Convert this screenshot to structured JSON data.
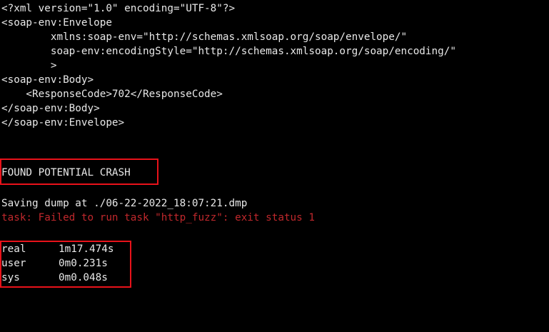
{
  "xml_lines": [
    "<?xml version=\"1.0\" encoding=\"UTF-8\"?>",
    "<soap-env:Envelope",
    "        xmlns:soap-env=\"http://schemas.xmlsoap.org/soap/envelope/\"",
    "        soap-env:encodingStyle=\"http://schemas.xmlsoap.org/soap/encoding/\"",
    "        >",
    "<soap-env:Body>",
    "    <ResponseCode>702</ResponseCode>",
    "</soap-env:Body>",
    "</soap-env:Envelope>"
  ],
  "crash_message": "FOUND POTENTIAL CRASH",
  "dump_message": "Saving dump at ./06-22-2022_18:07:21.dmp",
  "error_message": "task: Failed to run task \"http_fuzz\": exit status 1",
  "timing": [
    {
      "label": "real",
      "value": "1m17.474s"
    },
    {
      "label": "user",
      "value": "0m0.231s"
    },
    {
      "label": "sys",
      "value": "0m0.048s"
    }
  ],
  "colors": {
    "background": "#000000",
    "text": "#e8e8e8",
    "error": "#c0282c",
    "highlight_box": "#e8121a"
  }
}
